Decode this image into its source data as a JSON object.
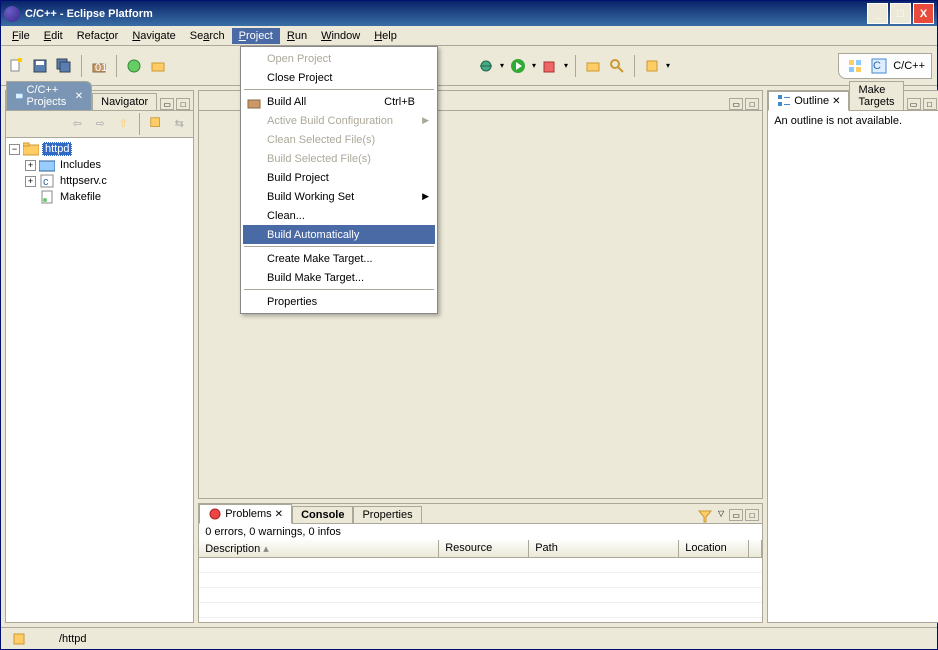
{
  "window": {
    "title": "C/C++ - Eclipse Platform"
  },
  "menubar": {
    "file": "File",
    "edit": "Edit",
    "refactor": "Refactor",
    "navigate": "Navigate",
    "search": "Search",
    "project": "Project",
    "run": "Run",
    "window": "Window",
    "help": "Help"
  },
  "perspective": {
    "label": "C/C++"
  },
  "project_menu": {
    "open_project": "Open Project",
    "close_project": "Close Project",
    "build_all": "Build All",
    "build_all_shortcut": "Ctrl+B",
    "active_build_config": "Active Build Configuration",
    "clean_selected": "Clean Selected File(s)",
    "build_selected": "Build Selected File(s)",
    "build_project": "Build Project",
    "build_working_set": "Build Working Set",
    "clean": "Clean...",
    "build_automatically": "Build Automatically",
    "create_make_target": "Create Make Target...",
    "build_make_target": "Build Make Target...",
    "properties": "Properties"
  },
  "left_panel": {
    "tab_projects": "C/C++ Projects",
    "tab_navigator": "Navigator",
    "tree": {
      "root": "httpd",
      "includes": "Includes",
      "httpserv": "httpserv.c",
      "makefile": "Makefile"
    }
  },
  "outline_panel": {
    "tab_outline": "Outline",
    "tab_make_targets": "Make Targets",
    "empty_text": "An outline is not available."
  },
  "bottom_panel": {
    "tab_problems": "Problems",
    "tab_console": "Console",
    "tab_properties": "Properties",
    "status": "0 errors, 0 warnings, 0 infos",
    "cols": {
      "description": "Description",
      "resource": "Resource",
      "path": "Path",
      "location": "Location"
    }
  },
  "statusbar": {
    "path": "/httpd"
  }
}
